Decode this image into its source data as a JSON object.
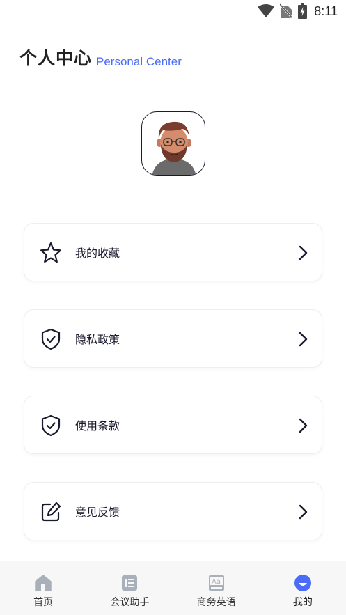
{
  "status_bar": {
    "time": "8:11",
    "icons": [
      "wifi-icon",
      "no-sim-icon",
      "battery-charging-icon"
    ]
  },
  "header": {
    "title": "个人中心",
    "subtitle": "Personal Center"
  },
  "colors": {
    "accent": "#4a6cf7",
    "icon_dark": "#1a1a2e",
    "nav_inactive": "#aab0ba",
    "nav_active": "#4a6cf7"
  },
  "menu": [
    {
      "label": "我的收藏",
      "icon": "star-icon"
    },
    {
      "label": "隐私政策",
      "icon": "shield-check-icon"
    },
    {
      "label": "使用条款",
      "icon": "shield-check-icon"
    },
    {
      "label": "意见反馈",
      "icon": "edit-icon"
    }
  ],
  "bottom_nav": [
    {
      "label": "首页",
      "icon": "home-icon",
      "active": false
    },
    {
      "label": "会议助手",
      "icon": "list-icon",
      "active": false
    },
    {
      "label": "商务英语",
      "icon": "dictionary-icon",
      "active": false
    },
    {
      "label": "我的",
      "icon": "profile-icon",
      "active": true
    }
  ]
}
